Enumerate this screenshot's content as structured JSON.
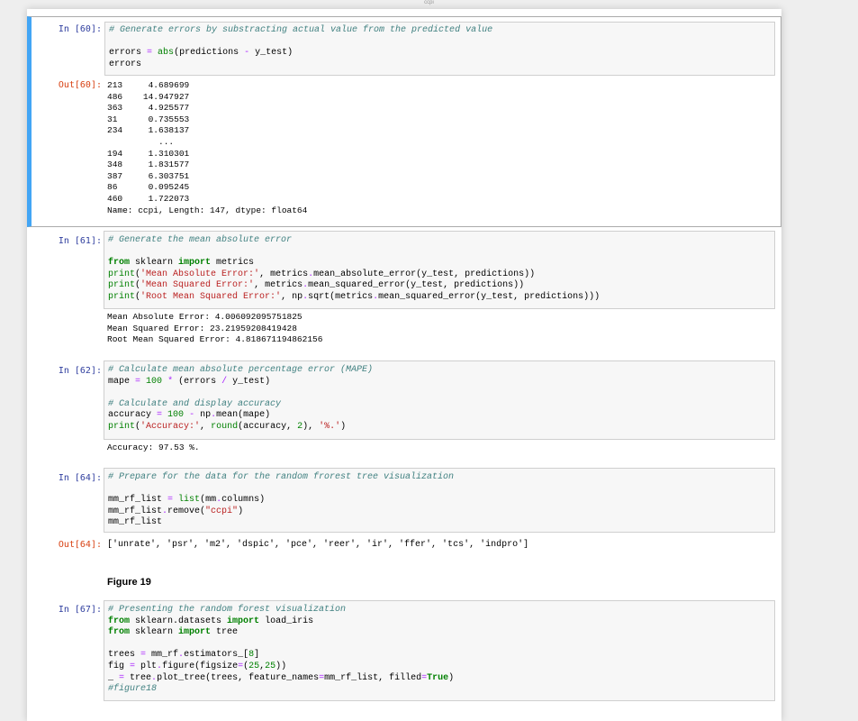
{
  "window": {
    "title": "ccpi"
  },
  "cells": [
    {
      "id": "c60",
      "in_prompt": "In [60]:",
      "code": [
        [
          {
            "t": "# Generate errors by substracting actual value from the predicted value",
            "c": "cm"
          }
        ],
        [],
        [
          {
            "t": "errors "
          },
          {
            "t": "=",
            "c": "op"
          },
          {
            "t": " "
          },
          {
            "t": "abs",
            "c": "bi"
          },
          {
            "t": "(predictions "
          },
          {
            "t": "-",
            "c": "op"
          },
          {
            "t": " y_test)"
          }
        ],
        [
          {
            "t": "errors"
          }
        ]
      ],
      "out_prompt": "Out[60]:",
      "output": "213     4.689699\n486    14.947927\n363     4.925577\n31      0.735553\n234     1.638137\n          ...\n194     1.310301\n348     1.831577\n387     6.303751\n86      0.095245\n460     1.722073\nName: ccpi, Length: 147, dtype: float64"
    },
    {
      "id": "c61",
      "in_prompt": "In [61]:",
      "code": [
        [
          {
            "t": "# Generate the mean absolute error",
            "c": "cm"
          }
        ],
        [],
        [
          {
            "t": "from",
            "c": "kw"
          },
          {
            "t": " sklearn "
          },
          {
            "t": "import",
            "c": "kw"
          },
          {
            "t": " metrics"
          }
        ],
        [
          {
            "t": "print",
            "c": "bi"
          },
          {
            "t": "("
          },
          {
            "t": "'Mean Absolute Error:'",
            "c": "st"
          },
          {
            "t": ", metrics"
          },
          {
            "t": ".",
            "c": "op"
          },
          {
            "t": "mean_absolute_error(y_test, predictions))"
          }
        ],
        [
          {
            "t": "print",
            "c": "bi"
          },
          {
            "t": "("
          },
          {
            "t": "'Mean Squared Error:'",
            "c": "st"
          },
          {
            "t": ", metrics"
          },
          {
            "t": ".",
            "c": "op"
          },
          {
            "t": "mean_squared_error(y_test, predictions))"
          }
        ],
        [
          {
            "t": "print",
            "c": "bi"
          },
          {
            "t": "("
          },
          {
            "t": "'Root Mean Squared Error:'",
            "c": "st"
          },
          {
            "t": ", np"
          },
          {
            "t": ".",
            "c": "op"
          },
          {
            "t": "sqrt(metrics"
          },
          {
            "t": ".",
            "c": "op"
          },
          {
            "t": "mean_squared_error(y_test, predictions)))"
          }
        ]
      ],
      "output": "Mean Absolute Error: 4.006092095751825\nMean Squared Error: 23.21959208419428\nRoot Mean Squared Error: 4.818671194862156"
    },
    {
      "id": "c62",
      "in_prompt": "In [62]:",
      "code": [
        [
          {
            "t": "# Calculate mean absolute percentage error (MAPE)",
            "c": "cm"
          }
        ],
        [
          {
            "t": "mape "
          },
          {
            "t": "=",
            "c": "op"
          },
          {
            "t": " "
          },
          {
            "t": "100",
            "c": "nu"
          },
          {
            "t": " "
          },
          {
            "t": "*",
            "c": "op"
          },
          {
            "t": " (errors "
          },
          {
            "t": "/",
            "c": "op"
          },
          {
            "t": " y_test)"
          }
        ],
        [],
        [
          {
            "t": "# Calculate and display accuracy",
            "c": "cm"
          }
        ],
        [
          {
            "t": "accuracy "
          },
          {
            "t": "=",
            "c": "op"
          },
          {
            "t": " "
          },
          {
            "t": "100",
            "c": "nu"
          },
          {
            "t": " "
          },
          {
            "t": "-",
            "c": "op"
          },
          {
            "t": " np"
          },
          {
            "t": ".",
            "c": "op"
          },
          {
            "t": "mean(mape)"
          }
        ],
        [
          {
            "t": "print",
            "c": "bi"
          },
          {
            "t": "("
          },
          {
            "t": "'Accuracy:'",
            "c": "st"
          },
          {
            "t": ", "
          },
          {
            "t": "round",
            "c": "bi"
          },
          {
            "t": "(accuracy, "
          },
          {
            "t": "2",
            "c": "nu"
          },
          {
            "t": "), "
          },
          {
            "t": "'%.'",
            "c": "st"
          },
          {
            "t": ")"
          }
        ]
      ],
      "output": "Accuracy: 97.53 %."
    },
    {
      "id": "c64",
      "in_prompt": "In [64]:",
      "code": [
        [
          {
            "t": "# Prepare for the data for the random frorest tree visualization",
            "c": "cm"
          }
        ],
        [],
        [
          {
            "t": "mm_rf_list "
          },
          {
            "t": "=",
            "c": "op"
          },
          {
            "t": " "
          },
          {
            "t": "list",
            "c": "bi"
          },
          {
            "t": "(mm"
          },
          {
            "t": ".",
            "c": "op"
          },
          {
            "t": "columns)"
          }
        ],
        [
          {
            "t": "mm_rf_list"
          },
          {
            "t": ".",
            "c": "op"
          },
          {
            "t": "remove("
          },
          {
            "t": "\"ccpi\"",
            "c": "st"
          },
          {
            "t": ")"
          }
        ],
        [
          {
            "t": "mm_rf_list"
          }
        ]
      ],
      "out_prompt": "Out[64]:",
      "output": "['unrate', 'psr', 'm2', 'dspic', 'pce', 'reer', 'ir', 'ffer', 'tcs', 'indpro']"
    },
    {
      "id": "fig",
      "figure_label": "Figure 19"
    },
    {
      "id": "c67",
      "in_prompt": "In [67]:",
      "code": [
        [
          {
            "t": "# Presenting the random forest visualization",
            "c": "cm"
          }
        ],
        [
          {
            "t": "from",
            "c": "kw"
          },
          {
            "t": " sklearn.datasets "
          },
          {
            "t": "import",
            "c": "kw"
          },
          {
            "t": " load_iris"
          }
        ],
        [
          {
            "t": "from",
            "c": "kw"
          },
          {
            "t": " sklearn "
          },
          {
            "t": "import",
            "c": "kw"
          },
          {
            "t": " tree"
          }
        ],
        [],
        [
          {
            "t": "trees "
          },
          {
            "t": "=",
            "c": "op"
          },
          {
            "t": " mm_rf"
          },
          {
            "t": ".",
            "c": "op"
          },
          {
            "t": "estimators_["
          },
          {
            "t": "8",
            "c": "nu"
          },
          {
            "t": "]"
          }
        ],
        [
          {
            "t": "fig "
          },
          {
            "t": "=",
            "c": "op"
          },
          {
            "t": " plt"
          },
          {
            "t": ".",
            "c": "op"
          },
          {
            "t": "figure(figsize"
          },
          {
            "t": "=",
            "c": "op"
          },
          {
            "t": "("
          },
          {
            "t": "25",
            "c": "nu"
          },
          {
            "t": ","
          },
          {
            "t": "25",
            "c": "nu"
          },
          {
            "t": "))"
          }
        ],
        [
          {
            "t": "_ "
          },
          {
            "t": "=",
            "c": "op"
          },
          {
            "t": " tree"
          },
          {
            "t": ".",
            "c": "op"
          },
          {
            "t": "plot_tree(trees, feature_names"
          },
          {
            "t": "=",
            "c": "op"
          },
          {
            "t": "mm_rf_list, filled"
          },
          {
            "t": "=",
            "c": "op"
          },
          {
            "t": "True",
            "c": "kw"
          },
          {
            "t": ")"
          }
        ],
        [
          {
            "t": "#figure18",
            "c": "cm"
          }
        ]
      ]
    }
  ]
}
